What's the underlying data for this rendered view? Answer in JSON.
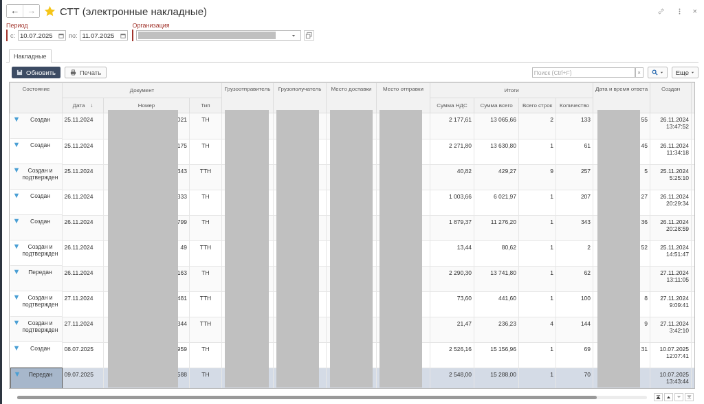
{
  "window": {
    "title": "СТТ (электронные накладные)",
    "back": "←",
    "forward": "→",
    "close": "×"
  },
  "filters": {
    "period_label": "Период",
    "from_label": "с:",
    "from": "10.07.2025",
    "to_label": "по:",
    "to": "11.07.2025",
    "org_label": "Организация"
  },
  "tabs": [
    {
      "label": "Накладные",
      "selected": true
    }
  ],
  "toolbar": {
    "refresh": "Обновить",
    "print": "Печать",
    "search_placeholder": "Поиск (Ctrl+F)",
    "clear": "×",
    "more": "Еще"
  },
  "columns": [
    {
      "label": "Состояние"
    },
    {
      "label": "Документ",
      "children": [
        {
          "label": "Дата",
          "sort_mark": "↓"
        },
        {
          "label": "Номер"
        },
        {
          "label": "Тип"
        }
      ]
    },
    {
      "label": "Грузоотправитель"
    },
    {
      "label": "Грузополучатель"
    },
    {
      "label": "Место доставки"
    },
    {
      "label": "Место отправки"
    },
    {
      "label": "Итоги",
      "children": [
        {
          "label": "Сумма НДС"
        },
        {
          "label": "Сумма всего"
        },
        {
          "label": "Всего строк"
        },
        {
          "label": "Количество"
        }
      ]
    },
    {
      "label": "Дата и время ответа"
    },
    {
      "label": "Создан"
    }
  ],
  "rows": [
    {
      "state": "Создан",
      "date": "25.11.2024",
      "number": "021",
      "type": "ТН",
      "vat": "2 177,61",
      "total": "13 065,66",
      "lines": "2",
      "qty": "133",
      "response": "55",
      "created_date": "26.11.2024",
      "created_time": "13:47:52",
      "selected": false
    },
    {
      "state": "Создан",
      "date": "25.11.2024",
      "number": "175",
      "type": "ТН",
      "vat": "2 271,80",
      "total": "13 630,80",
      "lines": "1",
      "qty": "61",
      "response": "45",
      "created_date": "26.11.2024",
      "created_time": "11:34:18",
      "selected": false
    },
    {
      "state": "Создан и подтвержден",
      "date": "25.11.2024",
      "number": "343",
      "type": "ТТН",
      "vat": "40,82",
      "total": "429,27",
      "lines": "9",
      "qty": "257",
      "response": "5",
      "created_date": "25.11.2024",
      "created_time": "5:25:10",
      "selected": false
    },
    {
      "state": "Создан",
      "date": "26.11.2024",
      "number": "333",
      "type": "ТН",
      "vat": "1 003,66",
      "total": "6 021,97",
      "lines": "1",
      "qty": "207",
      "response": "27",
      "created_date": "26.11.2024",
      "created_time": "20:29:34",
      "selected": false
    },
    {
      "state": "Создан",
      "date": "26.11.2024",
      "number": "799",
      "type": "ТН",
      "vat": "1 879,37",
      "total": "11 276,20",
      "lines": "1",
      "qty": "343",
      "response": "36",
      "created_date": "26.11.2024",
      "created_time": "20:28:59",
      "selected": false
    },
    {
      "state": "Создан и подтвержден",
      "date": "26.11.2024",
      "number": "49",
      "type": "ТТН",
      "vat": "13,44",
      "total": "80,62",
      "lines": "1",
      "qty": "2",
      "response": "52",
      "created_date": "25.11.2024",
      "created_time": "14:51:47",
      "selected": false
    },
    {
      "state": "Передан",
      "date": "26.11.2024",
      "number": "163",
      "type": "ТН",
      "vat": "2 290,30",
      "total": "13 741,80",
      "lines": "1",
      "qty": "62",
      "created_date": "27.11.2024",
      "created_time": "13:11:05",
      "selected": false
    },
    {
      "state": "Создан и подтвержден",
      "date": "27.11.2024",
      "number": "481",
      "type": "ТТН",
      "vat": "73,60",
      "total": "441,60",
      "lines": "1",
      "qty": "100",
      "response": "8",
      "created_date": "27.11.2024",
      "created_time": "9:09:41",
      "selected": false
    },
    {
      "state": "Создан и подтвержден",
      "date": "27.11.2024",
      "number": "344",
      "type": "ТТН",
      "vat": "21,47",
      "total": "236,23",
      "lines": "4",
      "qty": "144",
      "response": "9",
      "created_date": "27.11.2024",
      "created_time": "3:42:10",
      "selected": false
    },
    {
      "state": "Создан",
      "date": "08.07.2025",
      "number": "959",
      "type": "ТН",
      "vat": "2 526,16",
      "total": "15 156,96",
      "lines": "1",
      "qty": "69",
      "response": "31",
      "created_date": "10.07.2025",
      "created_time": "12:07:41",
      "selected": false
    },
    {
      "state": "Передан",
      "date": "09.07.2025",
      "number": "588",
      "type": "ТН",
      "vat": "2 548,00",
      "total": "15 288,00",
      "lines": "1",
      "qty": "70",
      "created_date": "10.07.2025",
      "created_time": "13:43:44",
      "selected": true
    }
  ]
}
